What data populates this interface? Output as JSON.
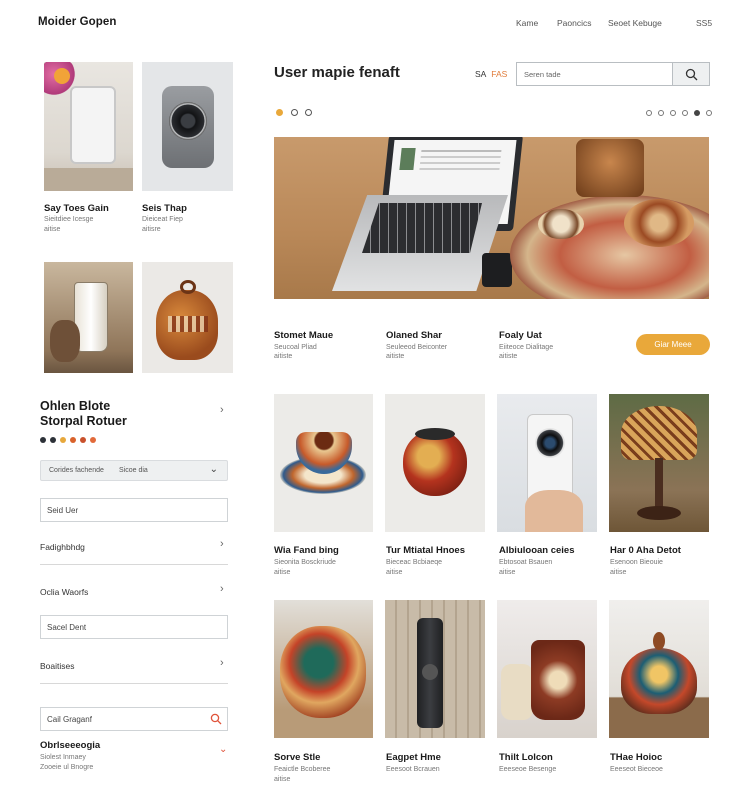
{
  "header": {
    "brand": "Moider Gopen",
    "nav": [
      "Kame",
      "Paoncics",
      "Seoet Kebuge",
      "SS5"
    ]
  },
  "sidebar_products": [
    {
      "title": "Say Toes Gain",
      "sub1": "Sieitdiee Icesge",
      "sub2": "aitise"
    },
    {
      "title": "Seis Thap",
      "sub1": "Dieiceat Fiep",
      "sub2": "aitisre"
    }
  ],
  "filters": {
    "title_line1": "Ohlen Blote",
    "title_line2": "Storpal Rotuer",
    "swatches": [
      "#2d3138",
      "#2d3138",
      "#e7a83c",
      "#d9622b",
      "#c9512c",
      "#e26a3a"
    ],
    "filter_bar_left": "Corides fachende",
    "filter_bar_right": "Sicoe dia",
    "field1": "Seid Uer",
    "accordion1": "Fadighbhdg",
    "accordion2": "Oclia Waorfs",
    "field2": "Sacel Dent",
    "accordion3": "Boaitises",
    "search2_placeholder": "Cail Graganf",
    "bottom_title": "Obrlseeeogia",
    "bottom_sub1": "Siolest Inmaey",
    "bottom_sub2": "Zooeie ul Bnogre"
  },
  "main": {
    "title": "User mapie fenaft",
    "price_dark": "SA",
    "price_accent": "FAS",
    "search_placeholder": "Seren tade",
    "featured": [
      {
        "title": "Stomet Maue",
        "sub1": "Seucoal Pliad",
        "sub2": "aitiste"
      },
      {
        "title": "Olaned Shar",
        "sub1": "Seuleeod Beiconter",
        "sub2": "aitiste"
      },
      {
        "title": "Foaly Uat",
        "sub1": "Eiiteoce Dialitage",
        "sub2": "aitiste"
      }
    ],
    "cta_label": "Giar Meee"
  },
  "grid": [
    {
      "title": "Wia Fand bing",
      "sub1": "Sieonita Bosckriude",
      "sub2": "aitise"
    },
    {
      "title": "Tur Mtiatal Hnoes",
      "sub1": "Bieceac Bcbiaeqe",
      "sub2": "aitise"
    },
    {
      "title": "Albiulooan ceies",
      "sub1": "Ebtosoat Bsauen",
      "sub2": "aitise"
    },
    {
      "title": "Har 0 Aha Detot",
      "sub1": "Esenoon Bieouie",
      "sub2": "aitise"
    },
    {
      "title": "Sorve Stle",
      "sub1": "Feaictle Bcoberee",
      "sub2": "aitise"
    },
    {
      "title": "Eagpet Hme",
      "sub1": "Eeesoot Bcrauen",
      "sub2": ""
    },
    {
      "title": "Thilt Lolcon",
      "sub1": "Eeeseoe Besenge",
      "sub2": ""
    },
    {
      "title": "THae Hoioc",
      "sub1": "Eeeseot Bieceoe",
      "sub2": ""
    }
  ],
  "colors": {
    "accent": "#e9a83a",
    "orange_dot": "#e07b39",
    "text": "#1a1a1a"
  }
}
